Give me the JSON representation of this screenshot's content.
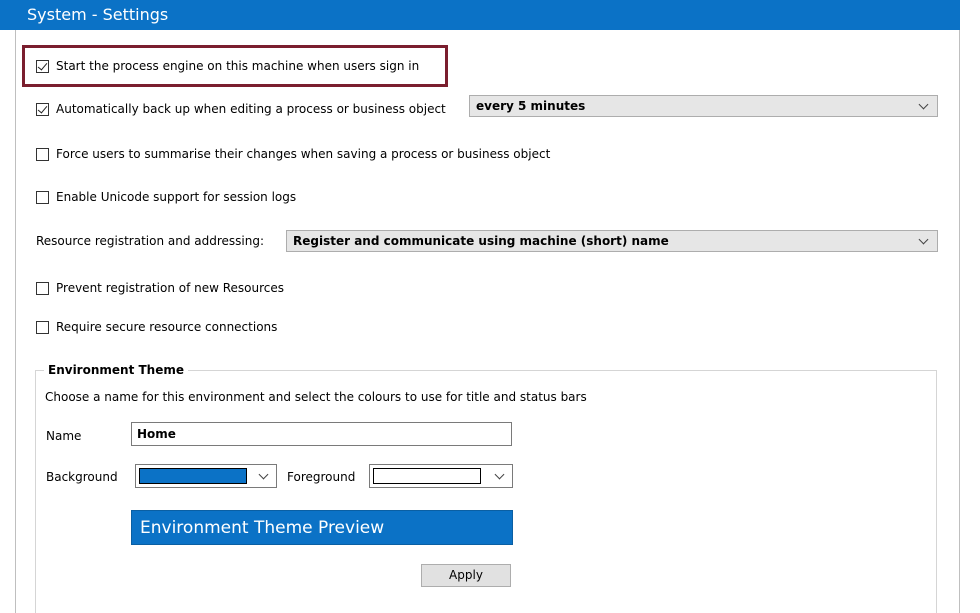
{
  "window": {
    "title": "System - Settings"
  },
  "options": {
    "start_engine": {
      "label": "Start the process engine on this machine when users sign in",
      "checked": true
    },
    "auto_backup": {
      "label": "Automatically back up when editing a process or business object",
      "checked": true,
      "interval": "every 5 minutes"
    },
    "force_summarise": {
      "label": "Force users to summarise their changes when saving a process or business object",
      "checked": false
    },
    "unicode_logs": {
      "label": "Enable Unicode support for session logs",
      "checked": false
    },
    "resource_registration": {
      "label": "Resource registration and addressing:",
      "value": "Register and communicate using machine (short) name"
    },
    "prevent_registration": {
      "label": "Prevent registration of new Resources",
      "checked": false
    },
    "secure_connections": {
      "label": "Require secure resource connections",
      "checked": false
    }
  },
  "theme": {
    "legend": "Environment Theme",
    "description": "Choose a name for this environment and select the colours to use for title and status bars",
    "name_label": "Name",
    "name_value": "Home",
    "background_label": "Background",
    "background_color": "#0b72c6",
    "foreground_label": "Foreground",
    "foreground_color": "#ffffff",
    "preview_text": "Environment Theme Preview",
    "apply_label": "Apply"
  }
}
